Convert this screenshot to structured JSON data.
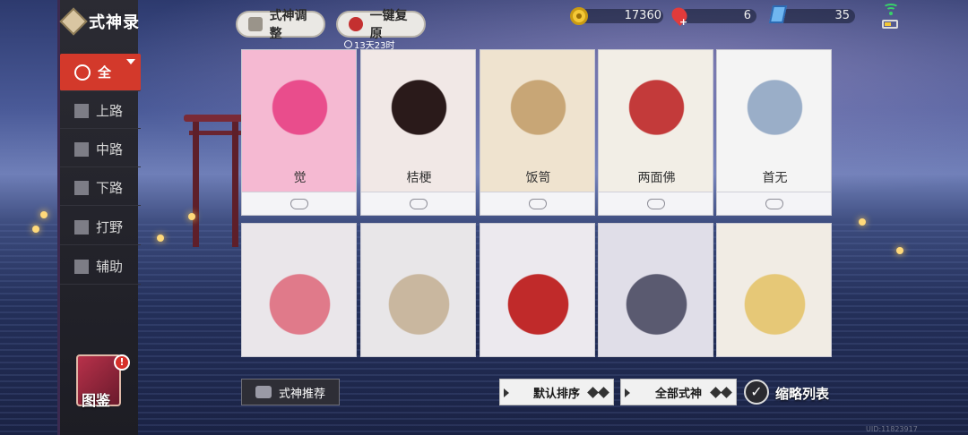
{
  "sidebar": {
    "title": "式神录",
    "items": [
      {
        "label": "全",
        "icon": "all-icon",
        "active": true
      },
      {
        "label": "上路",
        "icon": "top-lane-icon"
      },
      {
        "label": "中路",
        "icon": "mid-lane-icon"
      },
      {
        "label": "下路",
        "icon": "bottom-lane-icon"
      },
      {
        "label": "打野",
        "icon": "jungle-icon"
      },
      {
        "label": "辅助",
        "icon": "support-icon"
      }
    ],
    "book": {
      "label": "图鉴",
      "badge": "!"
    }
  },
  "toolbar": {
    "adjust_label": "式神调整",
    "restore_label": "一键复原",
    "countdown": "13天23时"
  },
  "currency": {
    "gold": "17360",
    "red": "6",
    "ticket": "35"
  },
  "cards_row1": [
    {
      "name": "觉",
      "palette": [
        "#f5b9d2",
        "#e94d8c"
      ]
    },
    {
      "name": "桔梗",
      "palette": [
        "#f1e8e6",
        "#2a1a1a"
      ]
    },
    {
      "name": "饭笥",
      "palette": [
        "#efe3cf",
        "#c8a676"
      ]
    },
    {
      "name": "两面佛",
      "palette": [
        "#f2eee6",
        "#c33a3a"
      ]
    },
    {
      "name": "首无",
      "palette": [
        "#f4f4f4",
        "#9aaec8"
      ]
    }
  ],
  "cards_row2": [
    {
      "palette": [
        "#eae6ea",
        "#e07a8a"
      ]
    },
    {
      "palette": [
        "#e8e6e8",
        "#c9b79f"
      ]
    },
    {
      "palette": [
        "#ece9ee",
        "#c02a2a"
      ]
    },
    {
      "palette": [
        "#e0dee8",
        "#5a5a70"
      ]
    },
    {
      "palette": [
        "#f1ece4",
        "#e6c877"
      ]
    }
  ],
  "bottom": {
    "recommend_label": "式神推荐",
    "sort_label": "默认排序",
    "filter_label": "全部式神",
    "thumbnail_label": "缩略列表",
    "uid": "UID:11823917"
  }
}
